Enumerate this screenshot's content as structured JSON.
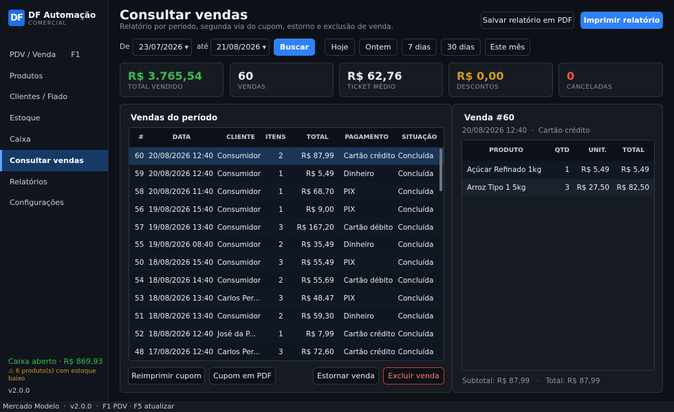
{
  "brand": {
    "logo": "DF",
    "name": "DF Automação",
    "subtitle": "COMERCIAL"
  },
  "nav": [
    {
      "label": "PDV / Venda",
      "shortcut": "F1"
    },
    {
      "label": "Produtos"
    },
    {
      "label": "Clientes / Fiado"
    },
    {
      "label": "Estoque"
    },
    {
      "label": "Caixa"
    },
    {
      "label": "Consultar vendas",
      "active": true
    },
    {
      "label": "Relatórios"
    },
    {
      "label": "Configurações"
    }
  ],
  "sidebar_footer": {
    "cash": "Caixa aberto · R$ 869,93",
    "stock_warning": "⚠ 6 produto(s) com estoque baixo",
    "version": "v2.0.0"
  },
  "statusbar": "Mercado Modelo  ·  v2.0.0  ·  F1 PDV · F5 atualizar",
  "header": {
    "title": "Consultar vendas",
    "subtitle": "Relatório por período, segunda via do cupom, estorno e exclusão de venda.",
    "save_pdf": "Salvar relatório em PDF",
    "print": "Imprimir relatório"
  },
  "filters": {
    "from_label": "De",
    "from_value": "23/07/2026",
    "to_label": "até",
    "to_value": "21/08/2026",
    "search": "Buscar",
    "quick": [
      "Hoje",
      "Ontem",
      "7 dias",
      "30 dias",
      "Este mês"
    ]
  },
  "kpis": [
    {
      "value": "R$ 3.765,54",
      "label": "TOTAL VENDIDO",
      "color": "#3fb950"
    },
    {
      "value": "60",
      "label": "VENDAS",
      "color": "#f0f6fc"
    },
    {
      "value": "R$ 62,76",
      "label": "TICKET MÉDIO",
      "color": "#f0f6fc"
    },
    {
      "value": "R$ 0,00",
      "label": "DESCONTOS",
      "color": "#d29922"
    },
    {
      "value": "0",
      "label": "CANCELADAS",
      "color": "#f85149"
    }
  ],
  "sales": {
    "title": "Vendas do período",
    "columns": [
      "#",
      "DATA",
      "CLIENTE",
      "ITENS",
      "TOTAL",
      "PAGAMENTO",
      "SITUAÇÃO"
    ],
    "rows": [
      {
        "num": "60",
        "date": "20/08/2026 12:40",
        "client": "Consumidor",
        "items": "2",
        "total": "R$ 87,99",
        "payment": "Cartão crédito",
        "status": "Concluída"
      },
      {
        "num": "59",
        "date": "20/08/2026 12:40",
        "client": "Consumidor",
        "items": "1",
        "total": "R$ 5,49",
        "payment": "Dinheiro",
        "status": "Concluída"
      },
      {
        "num": "58",
        "date": "20/08/2026 11:40",
        "client": "Consumidor",
        "items": "1",
        "total": "R$ 68,70",
        "payment": "PIX",
        "status": "Concluída"
      },
      {
        "num": "56",
        "date": "19/08/2026 15:40",
        "client": "Consumidor",
        "items": "1",
        "total": "R$ 9,00",
        "payment": "PIX",
        "status": "Concluída"
      },
      {
        "num": "57",
        "date": "19/08/2026 13:40",
        "client": "Consumidor",
        "items": "3",
        "total": "R$ 167,20",
        "payment": "Cartão débito",
        "status": "Concluída"
      },
      {
        "num": "55",
        "date": "19/08/2026 08:40",
        "client": "Consumidor",
        "items": "2",
        "total": "R$ 35,49",
        "payment": "Dinheiro",
        "status": "Concluída"
      },
      {
        "num": "50",
        "date": "18/08/2026 15:40",
        "client": "Consumidor",
        "items": "3",
        "total": "R$ 55,49",
        "payment": "PIX",
        "status": "Concluída"
      },
      {
        "num": "54",
        "date": "18/08/2026 14:40",
        "client": "Consumidor",
        "items": "2",
        "total": "R$ 55,69",
        "payment": "Cartão débito",
        "status": "Concluída"
      },
      {
        "num": "53",
        "date": "18/08/2026 13:40",
        "client": "Carlos Per...",
        "items": "3",
        "total": "R$ 48,47",
        "payment": "PIX",
        "status": "Concluída"
      },
      {
        "num": "51",
        "date": "18/08/2026 13:40",
        "client": "Consumidor",
        "items": "2",
        "total": "R$ 59,30",
        "payment": "Dinheiro",
        "status": "Concluída"
      },
      {
        "num": "52",
        "date": "18/08/2026 12:40",
        "client": "José da P...",
        "items": "1",
        "total": "R$ 7,99",
        "payment": "Cartão crédito",
        "status": "Concluída"
      },
      {
        "num": "48",
        "date": "17/08/2026 12:40",
        "client": "Carlos Per...",
        "items": "3",
        "total": "R$ 72,60",
        "payment": "Cartão crédito",
        "status": "Concluída"
      }
    ],
    "reprint": "Reimprimir cupom",
    "coupon_pdf": "Cupom em PDF",
    "reverse": "Estornar venda",
    "delete": "Excluir venda"
  },
  "detail": {
    "title": "Venda #60",
    "meta": "20/08/2026 12:40  ·  Cartão crédito",
    "columns": [
      "PRODUTO",
      "QTD",
      "UNIT.",
      "TOTAL"
    ],
    "items": [
      {
        "product": "Açúcar Refinado 1kg",
        "qty": "1",
        "unit": "R$ 5,49",
        "total": "R$ 5,49"
      },
      {
        "product": "Arroz Tipo 1 5kg",
        "qty": "3",
        "unit": "R$ 27,50",
        "total": "R$ 82,50"
      }
    ],
    "footer": "Subtotal: R$ 87,99   ·   Total: R$ 87,99"
  }
}
